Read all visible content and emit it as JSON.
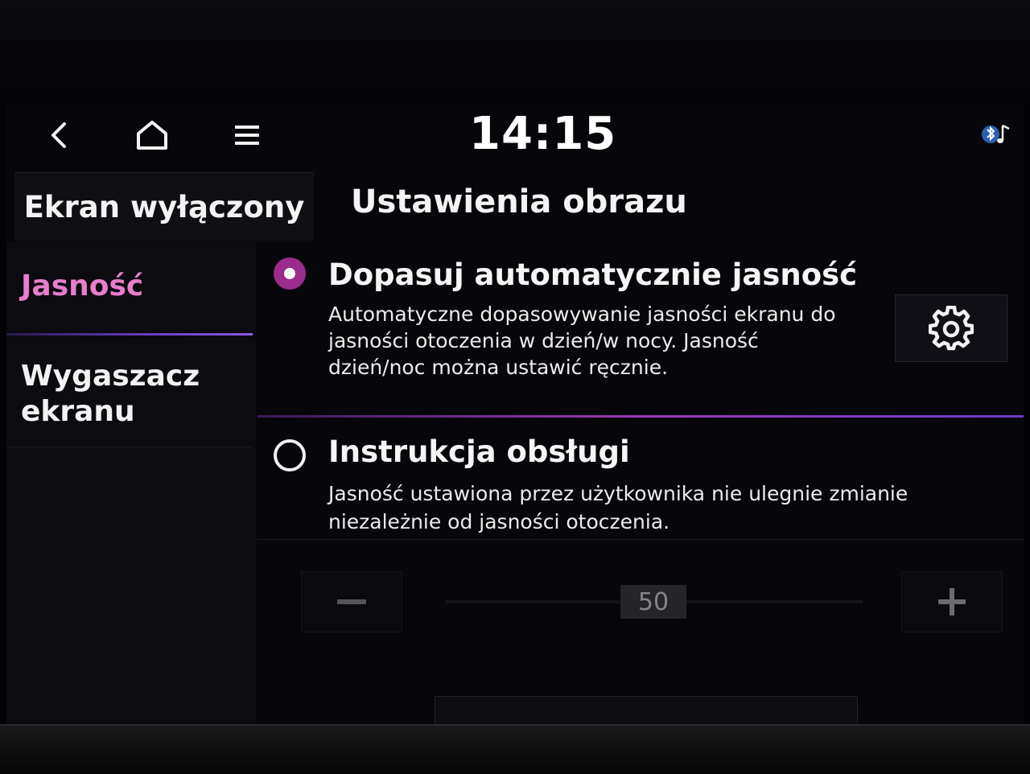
{
  "status_bar": {
    "time": "14:15",
    "icons": [
      "back-icon",
      "home-icon",
      "menu-icon",
      "bluetooth-music-icon"
    ]
  },
  "tabs": {
    "screen_off": "Ekran wyłączony"
  },
  "page": {
    "title": "Ustawienia obrazu"
  },
  "sidebar": {
    "items": [
      {
        "label": "Jasność",
        "active": true
      },
      {
        "label": "Wygaszacz ekranu",
        "active": false
      }
    ]
  },
  "options": [
    {
      "title": "Dopasuj automatycznie jasność",
      "description": "Automatyczne dopasowywanie jasności ekranu do jasności otoczenia w dzień/w nocy. Jasność dzień/noc można ustawić ręcznie.",
      "selected": true
    },
    {
      "title": "Instrukcja obsługi",
      "description": "Jasność ustawiona przez użytkownika nie ulegnie zmianie niezależnie od jasności otoczenia.",
      "selected": false
    }
  ],
  "brightness_slider": {
    "value": "50",
    "enabled": false
  },
  "colors": {
    "accent": "#9a2c8d",
    "active_text": "#e77dcb",
    "divider": "#9a3cb8"
  }
}
